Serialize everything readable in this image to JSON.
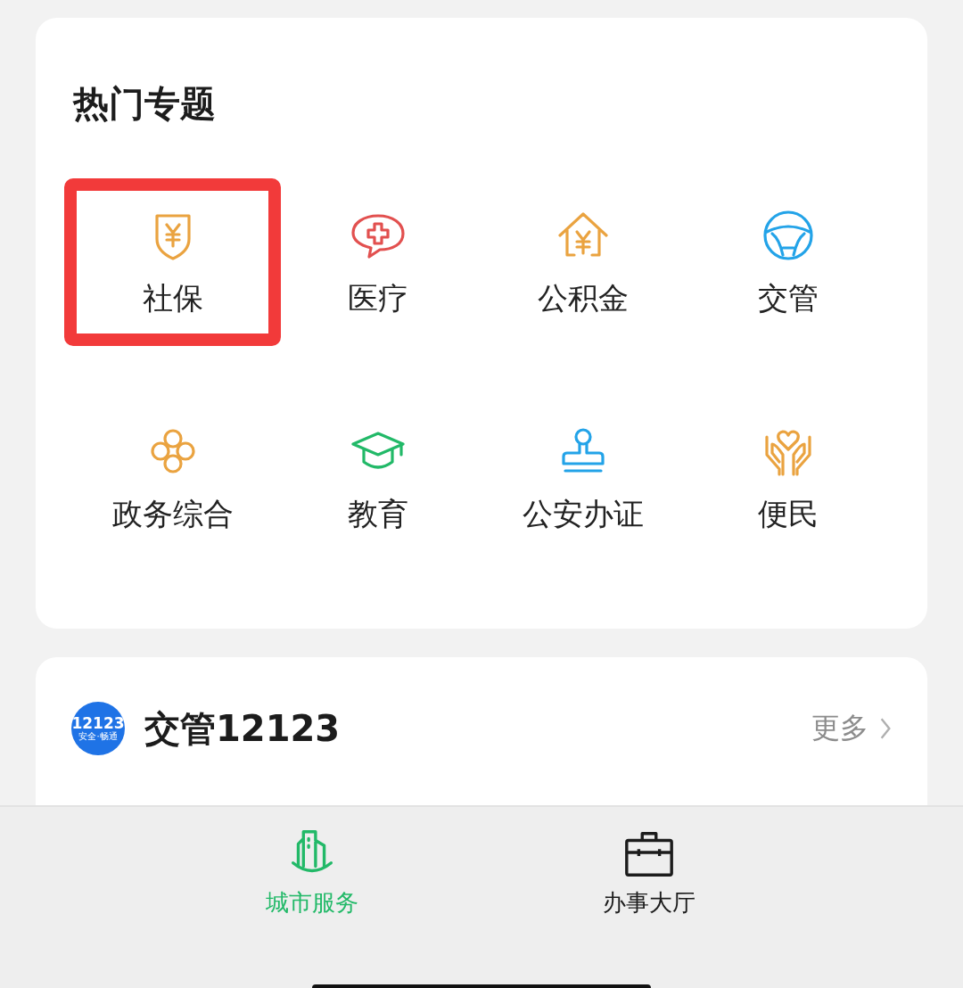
{
  "hot_topics": {
    "title": "热门专题",
    "items": [
      {
        "label": "社保",
        "highlighted": true
      },
      {
        "label": "医疗",
        "highlighted": false
      },
      {
        "label": "公积金",
        "highlighted": false
      },
      {
        "label": "交管",
        "highlighted": false
      },
      {
        "label": "政务综合",
        "highlighted": false
      },
      {
        "label": "教育",
        "highlighted": false
      },
      {
        "label": "公安办证",
        "highlighted": false
      },
      {
        "label": "便民",
        "highlighted": false
      }
    ]
  },
  "traffic_card": {
    "logo_number": "12123",
    "logo_slogan": "安全·畅通",
    "title": "交管12123",
    "more": "更多"
  },
  "bottom_nav": [
    {
      "label": "城市服务",
      "selected": true
    },
    {
      "label": "办事大厅",
      "selected": false
    }
  ]
}
